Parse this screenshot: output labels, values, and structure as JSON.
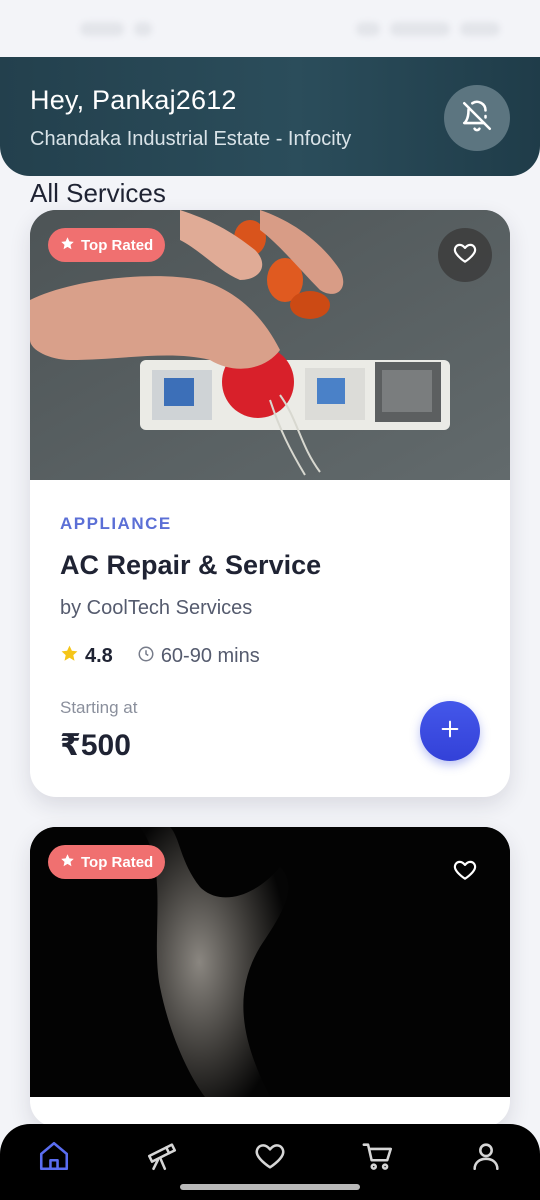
{
  "header": {
    "greeting": "Hey, Pankaj2612",
    "location": "Chandaka Industrial Estate - Infocity",
    "notifications_icon": "bell-off-icon"
  },
  "section": {
    "title": "All Services"
  },
  "cards": [
    {
      "badge": "Top Rated",
      "category": "APPLIANCE",
      "title": "AC Repair & Service",
      "provider": "by CoolTech Services",
      "rating": "4.8",
      "duration": "60-90 mins",
      "starting_label": "Starting at",
      "price": "₹500"
    },
    {
      "badge": "Top Rated"
    }
  ],
  "nav": {
    "items": [
      "home-icon",
      "telescope-icon",
      "heart-icon",
      "cart-icon",
      "user-icon"
    ],
    "active": "home-icon"
  },
  "colors": {
    "header_bg": "#2b4d5b",
    "accent": "#4457ea",
    "category": "#5b6fd6",
    "badge": "#f07070",
    "star": "#f5c518"
  }
}
